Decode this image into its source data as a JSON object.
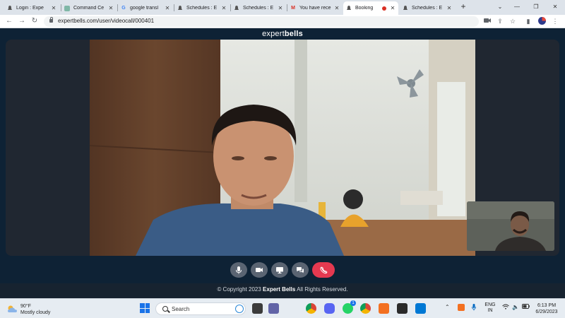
{
  "browser": {
    "tabs": [
      {
        "title": "Login : Expe",
        "icon": "expertbells-icon",
        "active": false
      },
      {
        "title": "Command Ce",
        "icon": "globe-icon",
        "active": false
      },
      {
        "title": "google transl",
        "icon": "google-icon",
        "active": false
      },
      {
        "title": "Schedules : E",
        "icon": "expertbells-icon",
        "active": false
      },
      {
        "title": "Schedules : E",
        "icon": "expertbells-icon",
        "active": false
      },
      {
        "title": "You have rece",
        "icon": "gmail-icon",
        "active": false
      },
      {
        "title": "Booking",
        "icon": "expertbells-icon",
        "active": true,
        "recording": true
      },
      {
        "title": "Schedules : E",
        "icon": "expertbells-icon",
        "active": false
      }
    ],
    "url": "expertbells.com/user/videocall/000401"
  },
  "page": {
    "logo_light": "expert",
    "logo_bold": "bells",
    "controls": [
      "microphone",
      "camera",
      "screen-share",
      "chat",
      "end-call"
    ],
    "footer_prefix": "© Copyright 2023",
    "footer_brand": "Expert Bells",
    "footer_suffix": "All Rights Reserved.",
    "end_call_color": "#e53950"
  },
  "taskbar": {
    "weather_temp": "90°F",
    "weather_condition": "Mostly cloudy",
    "search_placeholder": "Search",
    "apps": [
      {
        "name": "task-view",
        "badge": ""
      },
      {
        "name": "chat",
        "badge": ""
      },
      {
        "name": "chrome",
        "badge": ""
      },
      {
        "name": "discord",
        "badge": ""
      },
      {
        "name": "whatsapp",
        "badge": "1"
      },
      {
        "name": "chrome-profile",
        "badge": ""
      },
      {
        "name": "xampp",
        "badge": ""
      },
      {
        "name": "terminal",
        "badge": ""
      },
      {
        "name": "vscode",
        "badge": ""
      }
    ],
    "lang_line1": "ENG",
    "lang_line2": "IN",
    "time": "6:13 PM",
    "date": "6/29/2023"
  }
}
